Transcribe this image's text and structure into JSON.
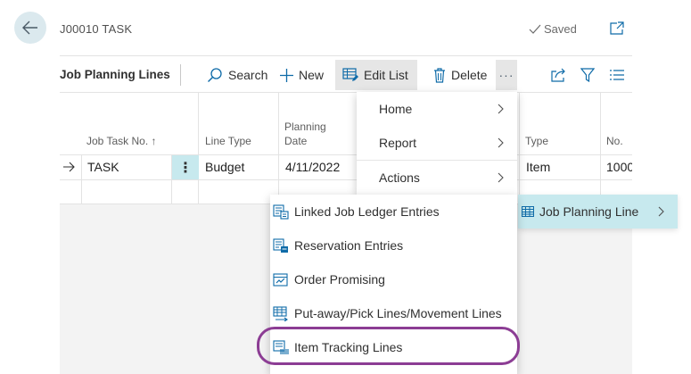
{
  "header": {
    "title": "J00010 TASK",
    "status": "Saved"
  },
  "actionbar": {
    "part_title": "Job Planning Lines",
    "search": "Search",
    "new": "New",
    "edit_list": "Edit List",
    "delete": "Delete",
    "more": "···"
  },
  "grid": {
    "columns": [
      "Job Task No. ↑",
      "Line Type",
      "Planning",
      "Date",
      "Type",
      "No."
    ],
    "row": {
      "job_task_no": "TASK",
      "line_type": "Budget",
      "planning_date": "4/11/2022",
      "type": "Item",
      "no": "1000"
    }
  },
  "menu1": {
    "items": [
      "Home",
      "Report",
      "Actions"
    ]
  },
  "submenu": {
    "label": "Job Planning Line"
  },
  "menu2": {
    "items": [
      "Linked Job Ledger Entries",
      "Reservation Entries",
      "Order Promising",
      "Put-away/Pick Lines/Movement Lines",
      "Item Tracking Lines"
    ]
  },
  "colors": {
    "accent": "#c7e9ee",
    "highlight": "#8c3d94",
    "icon_blue": "#0f6ba8"
  }
}
